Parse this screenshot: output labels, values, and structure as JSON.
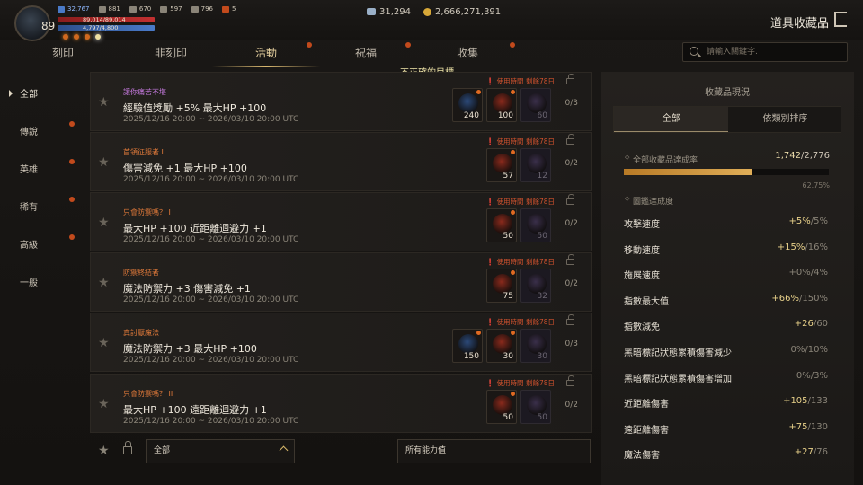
{
  "player": {
    "level": "89",
    "stats": [
      "32,767",
      "881",
      "670",
      "597",
      "796",
      "5"
    ],
    "hp_text": "89,014/89,014",
    "mp_text": "4,797/4,800"
  },
  "currency": {
    "crystals": "31,294",
    "gold": "2,666,271,391"
  },
  "header": {
    "title": "道具收藏品"
  },
  "tabs": [
    "刻印",
    "非刻印",
    "活動",
    "祝福",
    "收集"
  ],
  "search": {
    "placeholder": "請輸入關鍵字."
  },
  "warning": "不正確的目標。",
  "sidebar": {
    "items": [
      "全部",
      "傳說",
      "英雄",
      "稀有",
      "高級",
      "一般"
    ]
  },
  "items": [
    {
      "category": "讓你痛苦不堪",
      "cat_color": "#c77be0",
      "effect": "經驗值獎勵 +5% 最大HP +100",
      "date": "2025/12/16 20:00 ~ 2026/03/10 20:00 UTC",
      "time": "使用時間 剩餘78日",
      "progress": "0/3",
      "slots": [
        {
          "num": "240",
          "color": "#2c4a7a",
          "dim": false
        },
        {
          "num": "100",
          "color": "#8a2a1c",
          "dim": false
        },
        {
          "num": "60",
          "color": "#3a2f4a",
          "dim": true
        }
      ]
    },
    {
      "category": "首領征服者 I",
      "cat_color": "#e07a3a",
      "effect": "傷害減免 +1 最大HP +100",
      "date": "2025/12/16 20:00 ~ 2026/03/10 20:00 UTC",
      "time": "使用時間 剩餘78日",
      "progress": "0/2",
      "slots": [
        {
          "num": "57",
          "color": "#8a2a1c",
          "dim": false
        },
        {
          "num": "12",
          "color": "#3a2f4a",
          "dim": true
        }
      ]
    },
    {
      "category": "只會防禦嗎？ I",
      "cat_color": "#e07a3a",
      "effect": "最大HP +100 近距離迴避力 +1",
      "date": "2025/12/16 20:00 ~ 2026/03/10 20:00 UTC",
      "time": "使用時間 剩餘78日",
      "progress": "0/2",
      "slots": [
        {
          "num": "50",
          "color": "#8a2a1c",
          "dim": false
        },
        {
          "num": "50",
          "color": "#3a2f4a",
          "dim": true
        }
      ]
    },
    {
      "category": "防禦終結者",
      "cat_color": "#e07a3a",
      "effect": "魔法防禦力 +3 傷害減免 +1",
      "date": "2025/12/16 20:00 ~ 2026/03/10 20:00 UTC",
      "time": "使用時間 剩餘78日",
      "progress": "0/2",
      "slots": [
        {
          "num": "75",
          "color": "#8a2a1c",
          "dim": false
        },
        {
          "num": "32",
          "color": "#3a2f4a",
          "dim": true
        }
      ]
    },
    {
      "category": "真討厭魔法",
      "cat_color": "#e07a3a",
      "effect": "魔法防禦力 +3 最大HP +100",
      "date": "2025/12/16 20:00 ~ 2026/03/10 20:00 UTC",
      "time": "使用時間 剩餘78日",
      "progress": "0/3",
      "slots": [
        {
          "num": "150",
          "color": "#2c4a7a",
          "dim": false
        },
        {
          "num": "30",
          "color": "#8a2a1c",
          "dim": false
        },
        {
          "num": "30",
          "color": "#3a2f4a",
          "dim": true
        }
      ]
    },
    {
      "category": "只會防禦嗎？ II",
      "cat_color": "#e07a3a",
      "effect": "最大HP +100 遠距離迴避力 +1",
      "date": "2025/12/16 20:00 ~ 2026/03/10 20:00 UTC",
      "time": "使用時間 剩餘78日",
      "progress": "0/2",
      "slots": [
        {
          "num": "50",
          "color": "#8a2a1c",
          "dim": false
        },
        {
          "num": "50",
          "color": "#3a2f4a",
          "dim": true
        }
      ]
    }
  ],
  "filters": {
    "grade": "全部",
    "ability": "所有能力值"
  },
  "panel": {
    "title": "收藏品現況",
    "tabs": [
      "全部",
      "依類別排序"
    ],
    "total_label": "全部收藏品達成率",
    "total_current": "1,742",
    "total_max": "2,776",
    "total_percent": "62.75%",
    "total_fraction": 0.6275,
    "section_label": "圖鑑達成度",
    "rows": [
      {
        "label": "攻擊速度",
        "cur": "+5%",
        "max": "5%"
      },
      {
        "label": "移動速度",
        "cur": "+15%",
        "max": "16%"
      },
      {
        "label": "施展速度",
        "cur": "+0%",
        "max": "4%",
        "zero": true
      },
      {
        "label": "指數最大值",
        "cur": "+66%",
        "max": "150%"
      },
      {
        "label": "指數減免",
        "cur": "+26",
        "max": "60"
      },
      {
        "label": "黑暗標記狀態累積傷害減少",
        "cur": "0%",
        "max": "10%",
        "zero": true
      },
      {
        "label": "黑暗標記狀態累積傷害增加",
        "cur": "0%",
        "max": "3%",
        "zero": true
      },
      {
        "label": "近距離傷害",
        "cur": "+105",
        "max": "133"
      },
      {
        "label": "遠距離傷害",
        "cur": "+75",
        "max": "130"
      },
      {
        "label": "魔法傷害",
        "cur": "+27",
        "max": "76"
      }
    ]
  }
}
